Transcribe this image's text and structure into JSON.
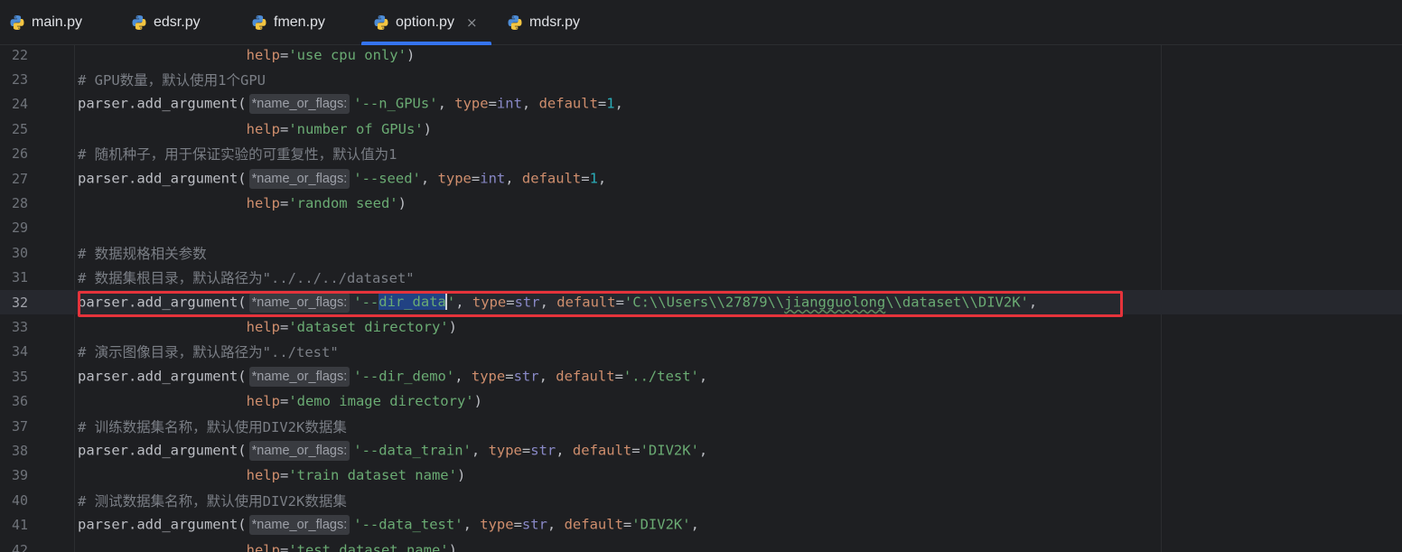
{
  "tabs": [
    {
      "label": "main.py",
      "active": false
    },
    {
      "label": "edsr.py",
      "active": false
    },
    {
      "label": "fmen.py",
      "active": false
    },
    {
      "label": "option.py",
      "active": true
    },
    {
      "label": "mdsr.py",
      "active": false
    }
  ],
  "tab_close_glyph": "×",
  "colors": {
    "accent": "#3574f0",
    "highlight_box": "#e5333b",
    "string": "#6aab73",
    "keyword_arg": "#cf8e6d",
    "number": "#2aacb8",
    "comment": "#7a7e85"
  },
  "hint_text": "*name_or_flags:",
  "lines": {
    "n22": "22",
    "n23": "23",
    "n24": "24",
    "n25": "25",
    "n26": "26",
    "n27": "27",
    "n28": "28",
    "n29": "29",
    "n30": "30",
    "n31": "31",
    "n32": "32",
    "n33": "33",
    "n34": "34",
    "n35": "35",
    "n36": "36",
    "n37": "37",
    "n38": "38",
    "n39": "39",
    "n40": "40",
    "n41": "41",
    "n42": "42"
  },
  "code": {
    "call": "parser.add_argument(",
    "indent": "                    ",
    "help": "help",
    "type": "type",
    "default": "default",
    "l22_help": "'use cpu only'",
    "l23_comment": "# GPU数量，默认使用1个GPU",
    "l24_flag": "'--n_GPUs'",
    "l24_type": "int",
    "l24_default": "1",
    "l25_help": "'number of GPUs'",
    "l26_comment": "# 随机种子，用于保证实验的可重复性，默认值为1",
    "l27_flag": "'--seed'",
    "l27_type": "int",
    "l27_default": "1",
    "l28_help": "'random seed'",
    "l30_comment": "# 数据规格相关参数",
    "l31_comment": "# 数据集根目录，默认路径为\"../../../dataset\"",
    "l32_flag_prefix": "'--",
    "l32_flag_selected": "dir_data",
    "l32_flag_suffix": "'",
    "l32_type": "str",
    "l32_default_a": "'C:\\\\Users\\\\27879\\\\",
    "l32_default_b": "jiangguolong",
    "l32_default_c": "\\\\dataset\\\\DIV2K'",
    "l33_help": "'dataset directory'",
    "l34_comment": "# 演示图像目录，默认路径为\"../test\"",
    "l35_flag": "'--dir_demo'",
    "l35_type": "str",
    "l35_default": "'../test'",
    "l36_help": "'demo image directory'",
    "l37_comment": "# 训练数据集名称，默认使用DIV2K数据集",
    "l38_flag": "'--data_train'",
    "l38_type": "str",
    "l38_default": "'DIV2K'",
    "l39_help": "'train dataset name'",
    "l40_comment": "# 测试数据集名称，默认使用DIV2K数据集",
    "l41_flag": "'--data_test'",
    "l41_type": "str",
    "l41_default": "'DIV2K'",
    "l42_help": "'test dataset name'"
  }
}
